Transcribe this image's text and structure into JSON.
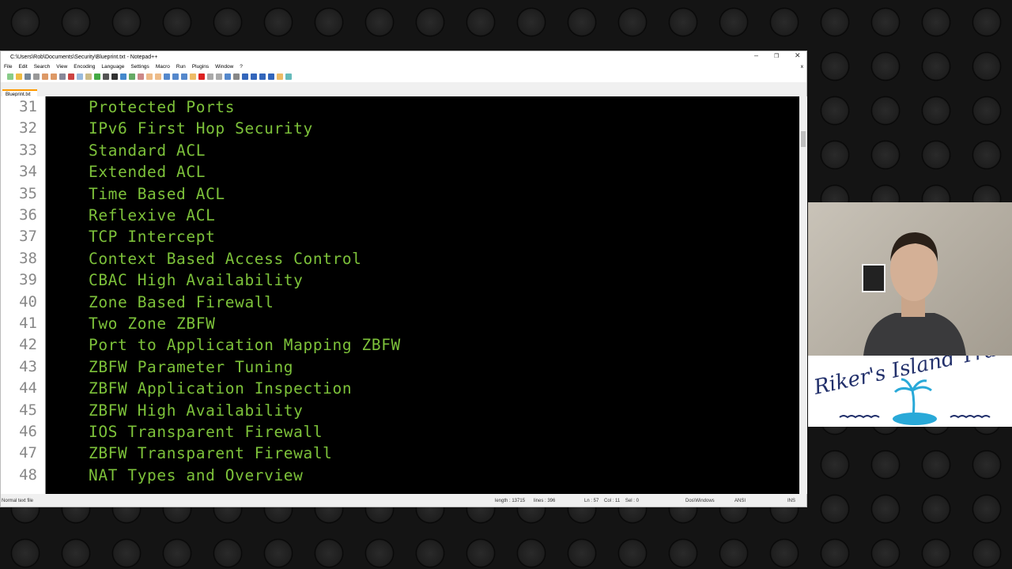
{
  "window": {
    "title": "C:\\Users\\Rob\\Documents\\Security\\Blueprint.txt - Notepad++",
    "minimize": "–",
    "restore": "❐",
    "close": "✕",
    "close_doc": "x"
  },
  "menu": [
    "File",
    "Edit",
    "Search",
    "View",
    "Encoding",
    "Language",
    "Settings",
    "Macro",
    "Run",
    "Plugins",
    "Window",
    "?"
  ],
  "tab": {
    "label": "Blueprint.txt"
  },
  "editor": {
    "lines": [
      {
        "n": "31",
        "t": "Protected Ports"
      },
      {
        "n": "32",
        "t": "IPv6 First Hop Security"
      },
      {
        "n": "33",
        "t": "Standard ACL"
      },
      {
        "n": "34",
        "t": "Extended ACL"
      },
      {
        "n": "35",
        "t": "Time Based ACL"
      },
      {
        "n": "36",
        "t": "Reflexive ACL"
      },
      {
        "n": "37",
        "t": "TCP Intercept"
      },
      {
        "n": "38",
        "t": "Context Based Access Control"
      },
      {
        "n": "39",
        "t": "CBAC High Availability"
      },
      {
        "n": "40",
        "t": "Zone Based Firewall"
      },
      {
        "n": "41",
        "t": "Two Zone ZBFW"
      },
      {
        "n": "42",
        "t": "Port to Application Mapping ZBFW"
      },
      {
        "n": "43",
        "t": "ZBFW Parameter Tuning"
      },
      {
        "n": "44",
        "t": "ZBFW Application Inspection"
      },
      {
        "n": "45",
        "t": "ZBFW High Availability"
      },
      {
        "n": "46",
        "t": "IOS Transparent Firewall"
      },
      {
        "n": "47",
        "t": "ZBFW Transparent Firewall"
      },
      {
        "n": "48",
        "t": "NAT Types and Overview"
      }
    ],
    "text_color": "#7dc23a"
  },
  "status": {
    "file_type": "Normal text file",
    "length": "length : 13715",
    "lines": "lines : 396",
    "position": "Ln : 57    Col : 11    Sel : 0",
    "eol": "Dos\\Windows",
    "encoding": "ANSI",
    "mode": "INS"
  },
  "logo": {
    "text": "Riker's Island Training"
  }
}
